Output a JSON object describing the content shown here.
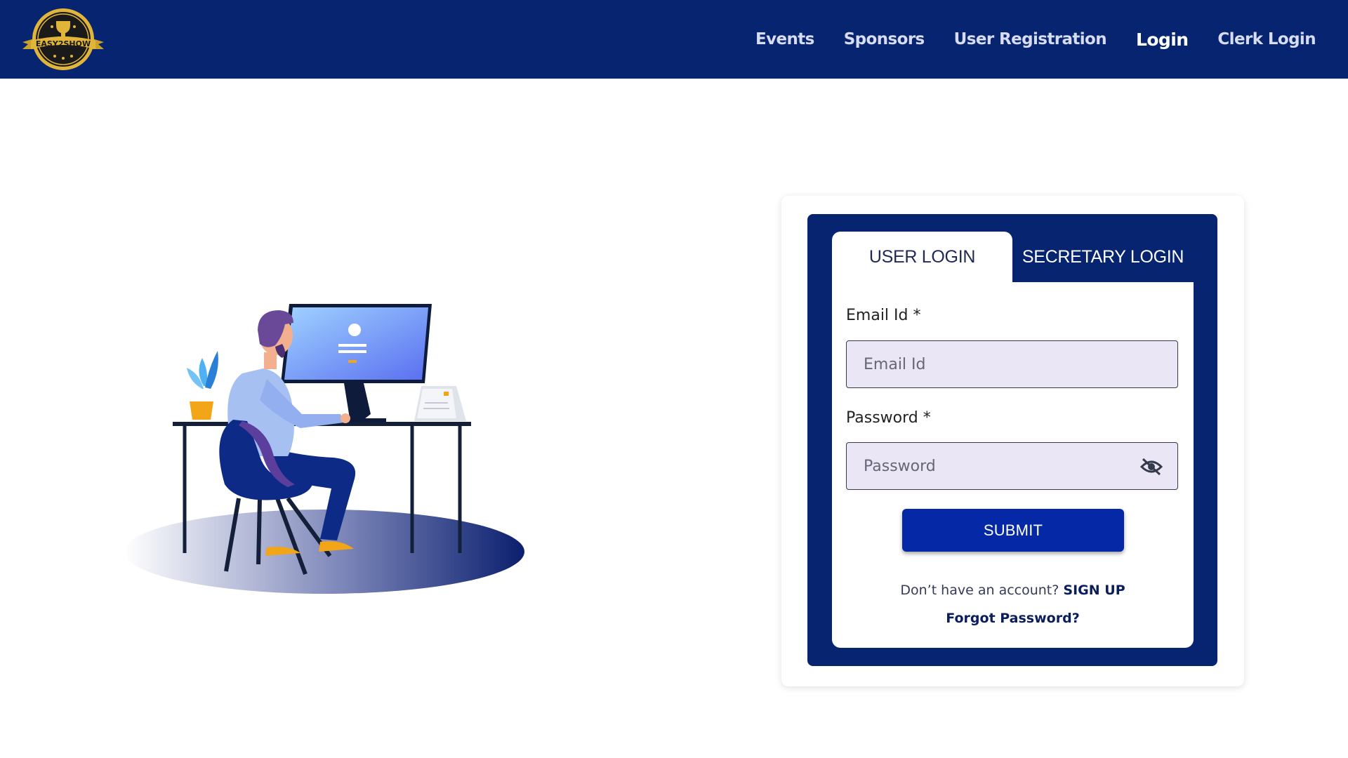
{
  "header": {
    "logo_text": "EASY2SHOW",
    "nav": [
      {
        "label": "Events"
      },
      {
        "label": "Sponsors"
      },
      {
        "label": "User Registration"
      },
      {
        "label": "Login"
      },
      {
        "label": "Clerk Login"
      }
    ],
    "active_nav": "Login"
  },
  "login": {
    "tabs": [
      {
        "label": "USER LOGIN"
      },
      {
        "label": "SECRETARY LOGIN"
      }
    ],
    "active_tab": "USER LOGIN",
    "email": {
      "label": "Email Id *",
      "placeholder": "Email Id",
      "value": ""
    },
    "password": {
      "label": "Password *",
      "placeholder": "Password",
      "value": ""
    },
    "submit_label": "SUBMIT",
    "signup_prompt": "Don’t have an account?",
    "signup_link": "SIGN UP",
    "forgot_link": "Forgot Password?"
  },
  "colors": {
    "navy": "#072470",
    "submit_blue": "#0529a6",
    "field_bg": "#eae6f6"
  }
}
